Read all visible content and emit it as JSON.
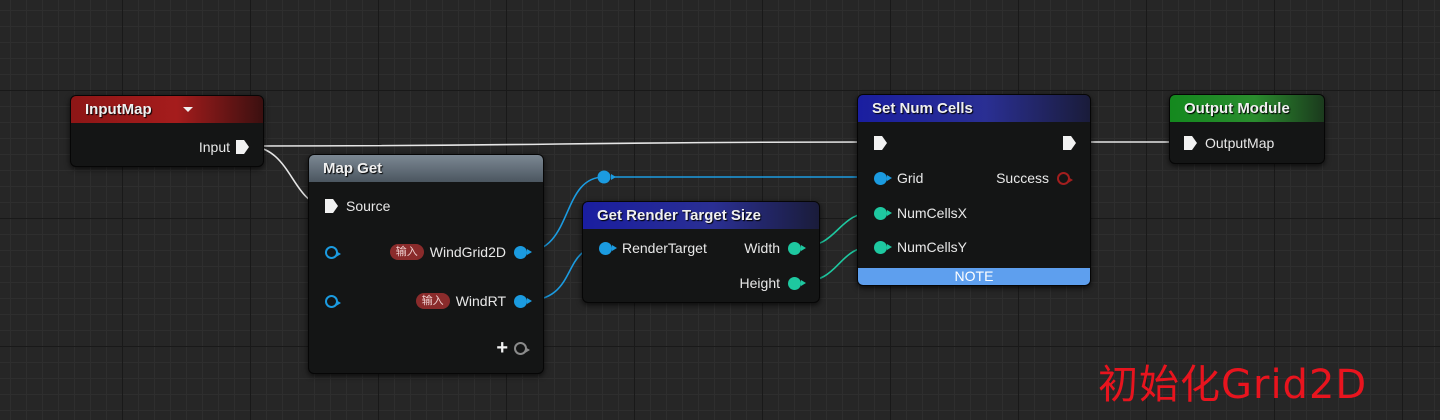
{
  "nodes": {
    "input_map": {
      "title": "InputMap",
      "pin_input": "Input"
    },
    "map_get": {
      "title": "Map Get",
      "pin_source": "Source",
      "pin_windgrid": "WindGrid2D",
      "pin_windrt": "WindRT",
      "input_tag": "输入"
    },
    "get_rt_size": {
      "title": "Get Render Target Size",
      "pin_render_target": "RenderTarget",
      "pin_width": "Width",
      "pin_height": "Height"
    },
    "set_num_cells": {
      "title": "Set Num Cells",
      "pin_grid": "Grid",
      "pin_success": "Success",
      "pin_numcellsx": "NumCellsX",
      "pin_numcellsy": "NumCellsY",
      "note": "NOTE"
    },
    "output_module": {
      "title": "Output Module",
      "pin_output_map": "OutputMap"
    }
  },
  "caption": "初始化Grid2D",
  "icons": {
    "exec_pin": "exec-arrow-icon",
    "data_pin": "pin-dot-icon",
    "add_pin": "plus-icon",
    "dropdown": "chevron-down-icon"
  },
  "colors": {
    "exec_wire": "#e6e6e6",
    "object_wire": "#1b9be0",
    "int_wire": "#1ec8a0",
    "caption": "#e8141e",
    "note_bar": "#5e9fee"
  }
}
